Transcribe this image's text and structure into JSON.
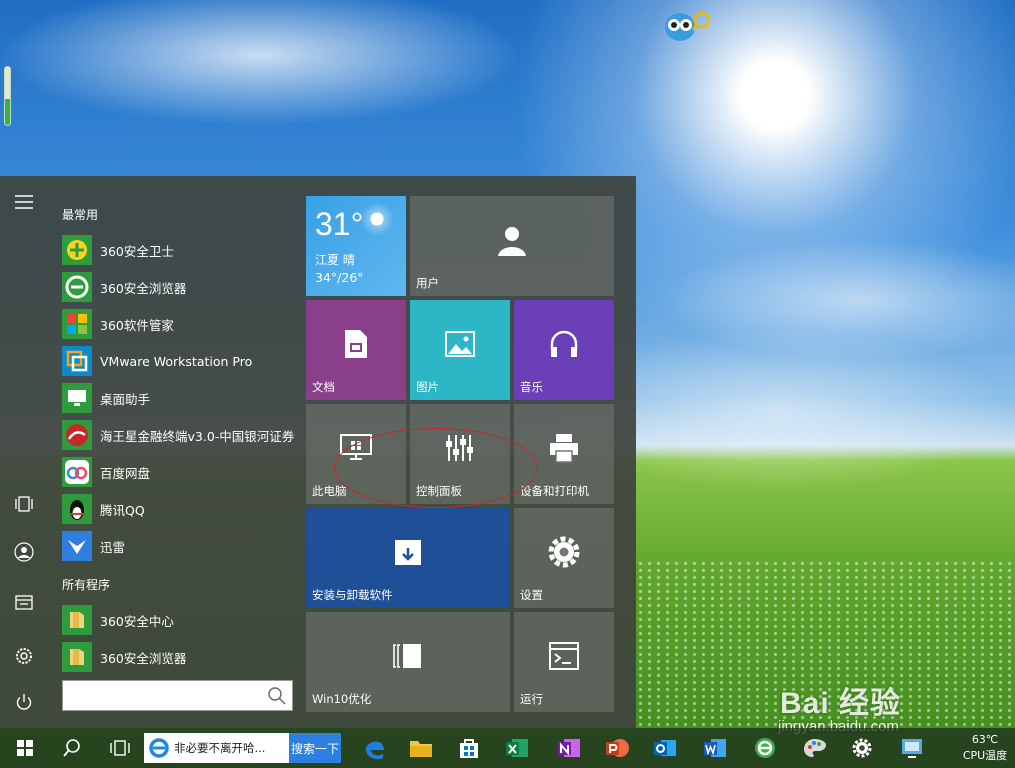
{
  "start_menu": {
    "most_used_label": "最常用",
    "most_used": [
      {
        "label": "360安全卫士",
        "icon": "360-security-guard-icon"
      },
      {
        "label": "360安全浏览器",
        "icon": "360-browser-icon"
      },
      {
        "label": "360软件管家",
        "icon": "360-software-manager-icon"
      },
      {
        "label": "VMware Workstation Pro",
        "icon": "vmware-icon"
      },
      {
        "label": "桌面助手",
        "icon": "desktop-assistant-icon"
      },
      {
        "label": "海王星金融终端v3.0-中国银河证券",
        "icon": "neptune-finance-icon"
      },
      {
        "label": "百度网盘",
        "icon": "baidu-netdisk-icon"
      },
      {
        "label": "腾讯QQ",
        "icon": "qq-penguin-icon"
      },
      {
        "label": "迅雷",
        "icon": "xunlei-bird-icon"
      }
    ],
    "all_programs_label": "所有程序",
    "all_programs": [
      {
        "label": "360安全中心",
        "icon": "folder-icon"
      },
      {
        "label": "360安全浏览器",
        "icon": "folder-icon"
      }
    ],
    "search": {
      "value": "",
      "placeholder": ""
    }
  },
  "tiles": {
    "weather": {
      "temp": "31°",
      "city": "江夏  晴",
      "range": "34°/26°"
    },
    "user": "用户",
    "documents": "文档",
    "pictures": "图片",
    "music": "音乐",
    "this_pc": "此电脑",
    "control_panel": "控制面板",
    "devices_printers": "设备和打印机",
    "install_uninstall": "安装与卸载软件",
    "settings": "设置",
    "win10_optimize": "Win10优化",
    "run": "运行"
  },
  "taskbar": {
    "ie_search_text": "非必要不离开哈...",
    "search_button": "搜索一下",
    "cpu_temp": "63℃",
    "cpu_label": "CPU温度"
  },
  "watermark": {
    "brand": "Bai 经验",
    "url": "jingyan.baidu.com"
  },
  "colors": {
    "weather_tile": "#39a0e6",
    "documents_tile": "#8a3f8a",
    "pictures_tile": "#2cb6c6",
    "music_tile": "#6a3fb8",
    "install_tile": "#1f4f96",
    "annotation_ellipse": "#c62828"
  }
}
